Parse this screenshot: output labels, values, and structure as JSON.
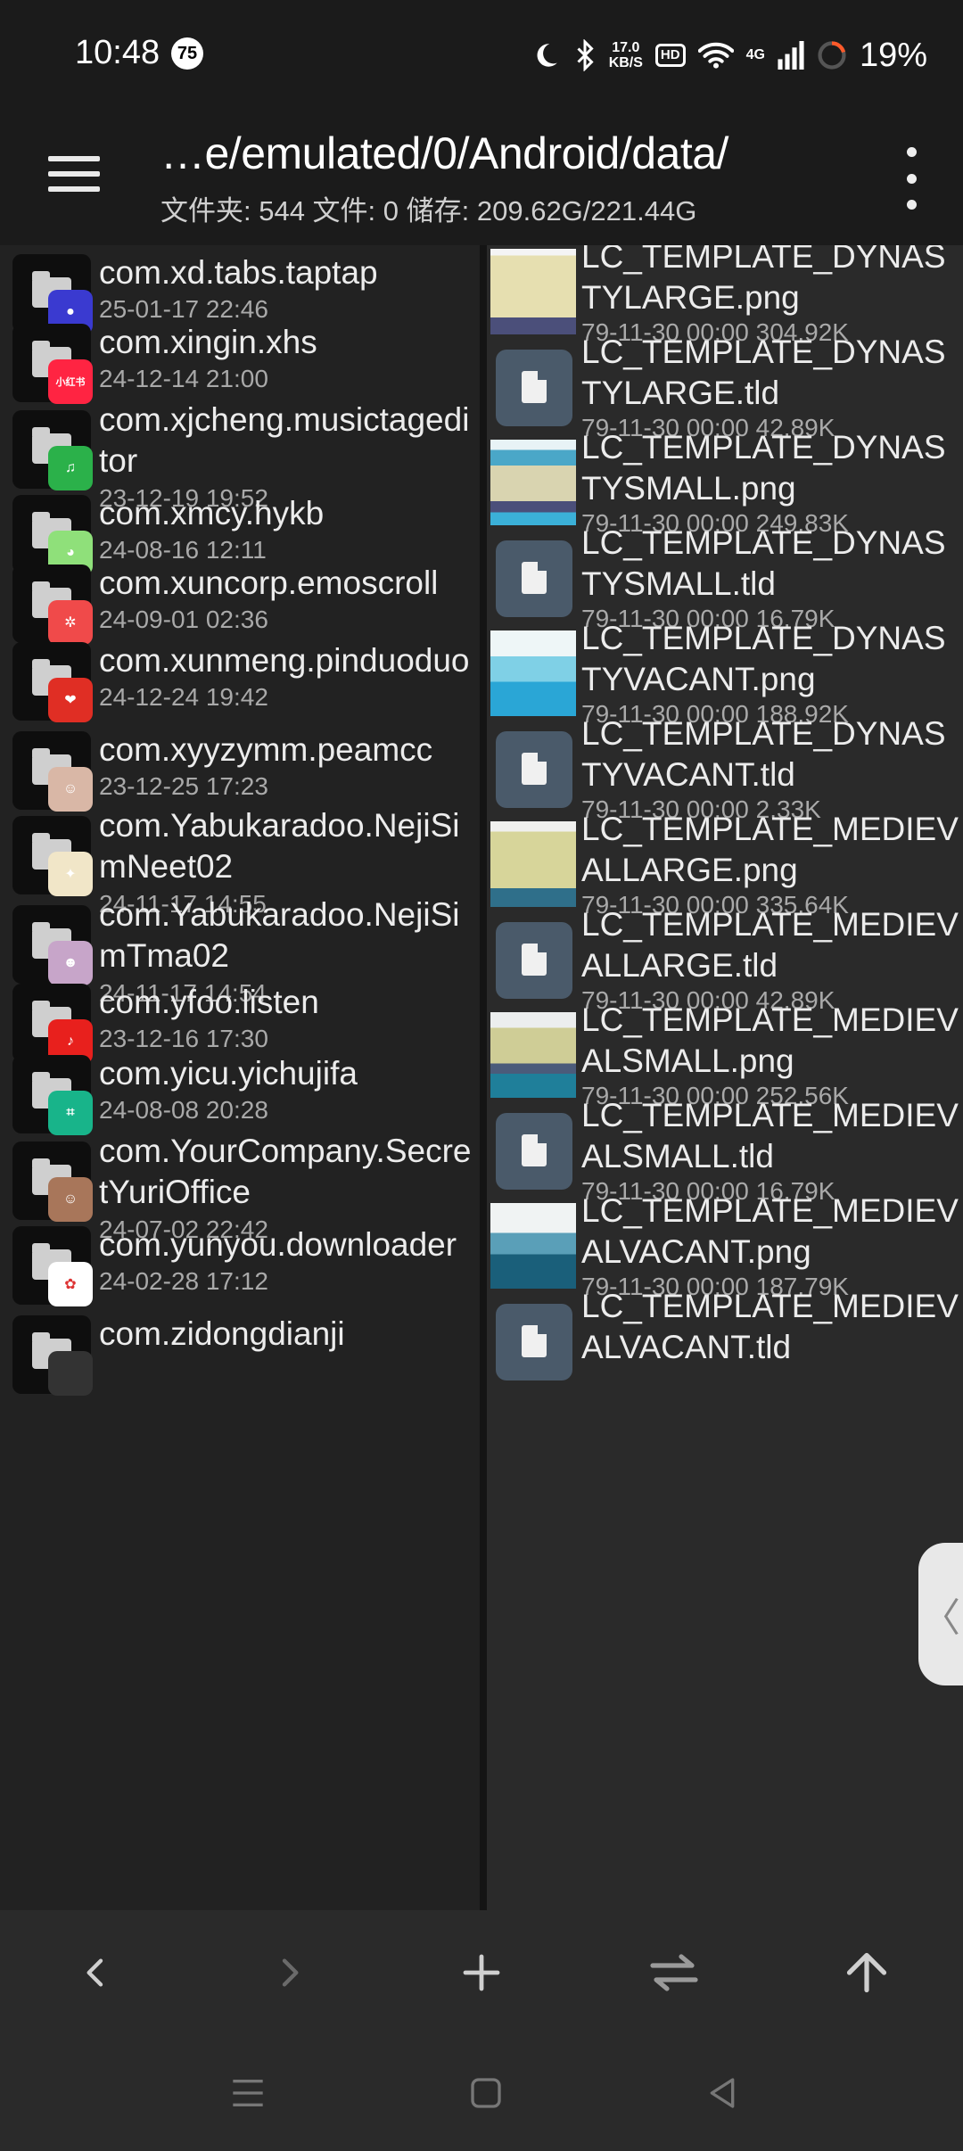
{
  "status": {
    "time": "10:48",
    "notification_count": "75",
    "speed_top": "17.0",
    "speed_unit": "KB/S",
    "hd": "HD",
    "network": "4G",
    "battery": "19%"
  },
  "appbar": {
    "path": "…e/emulated/0/Android/data/",
    "summary": "文件夹: 544  文件: 0  储存: 209.62G/221.44G"
  },
  "left_pane": {
    "items": [
      {
        "name": "com.xd.tabs.taptap",
        "date": "25-01-17 22:46",
        "icon": "taptap-icon",
        "color": "#3a3ad0",
        "glyph": "●"
      },
      {
        "name": "com.xingin.xhs",
        "date": "24-12-14 21:00",
        "icon": "xiaohongshu-icon",
        "color": "#ff2442",
        "glyph": "小红书"
      },
      {
        "name": "com.xjcheng.musictageditor",
        "date": "23-12-19 19:52",
        "icon": "music-note-icon",
        "color": "#2bb14a",
        "glyph": "♫"
      },
      {
        "name": "com.xmcy.hykb",
        "date": "24-08-16 12:11",
        "icon": "hykb-icon",
        "color": "#8fe07a",
        "glyph": "◕"
      },
      {
        "name": "com.xuncorp.emoscroll",
        "date": "24-09-01 02:36",
        "icon": "emoscroll-icon",
        "color": "#f04a4a",
        "glyph": "✲"
      },
      {
        "name": "com.xunmeng.pinduoduo",
        "date": "24-12-24 19:42",
        "icon": "pinduoduo-icon",
        "color": "#e02e24",
        "glyph": "❤"
      },
      {
        "name": "com.xyyzymm.peamcc",
        "date": "23-12-25 17:23",
        "icon": "anime-avatar-icon",
        "color": "#d9b7a6",
        "glyph": "☺"
      },
      {
        "name": "com.Yabukaradoo.NejiSimNeet02",
        "date": "24-11-17 14:55",
        "icon": "game-logo-icon",
        "color": "#f1e6c8",
        "glyph": "✦"
      },
      {
        "name": "com.Yabukaradoo.NejiSimTma02",
        "date": "24-11-17 14:54",
        "icon": "game-character-icon",
        "color": "#c7a5c9",
        "glyph": "☻"
      },
      {
        "name": "com.yfoo.listen",
        "date": "23-12-16 17:30",
        "icon": "music-listen-icon",
        "color": "#e8201d",
        "glyph": "♪"
      },
      {
        "name": "com.yicu.yichujifa",
        "date": "24-08-08 20:28",
        "icon": "scan-icon",
        "color": "#18b48a",
        "glyph": "⌗"
      },
      {
        "name": "com.YourCompany.SecretYuriOffice",
        "date": "24-07-02 22:42",
        "icon": "girl-avatar-icon",
        "color": "#a8765a",
        "glyph": "☺"
      },
      {
        "name": "com.yunyou.downloader",
        "date": "24-02-28 17:12",
        "icon": "downloader-icon",
        "color": "#ffffff",
        "glyph": "✿"
      },
      {
        "name": "com.zidongdianji",
        "date": "",
        "icon": "app-icon",
        "color": "#333333",
        "glyph": ""
      }
    ]
  },
  "right_pane": {
    "items": [
      {
        "name": "LC_TEMPLATE_DYNASTYLARGE.png",
        "date": "79-11-30 00:00",
        "size": "304.92K",
        "kind": "image",
        "thumb": "dynasty-large"
      },
      {
        "name": "LC_TEMPLATE_DYNASTYLARGE.tld",
        "date": "79-11-30 00:00",
        "size": "42.89K",
        "kind": "doc"
      },
      {
        "name": "LC_TEMPLATE_DYNASTYSMALL.png",
        "date": "79-11-30 00:00",
        "size": "249.83K",
        "kind": "image",
        "thumb": "dynasty-small"
      },
      {
        "name": "LC_TEMPLATE_DYNASTYSMALL.tld",
        "date": "79-11-30 00:00",
        "size": "16.79K",
        "kind": "doc"
      },
      {
        "name": "LC_TEMPLATE_DYNASTYVACANT.png",
        "date": "79-11-30 00:00",
        "size": "188.92K",
        "kind": "image",
        "thumb": "dynasty-vacant"
      },
      {
        "name": "LC_TEMPLATE_DYNASTYVACANT.tld",
        "date": "79-11-30 00:00",
        "size": "2.33K",
        "kind": "doc"
      },
      {
        "name": "LC_TEMPLATE_MEDIEVALLARGE.png",
        "date": "79-11-30 00:00",
        "size": "335.64K",
        "kind": "image",
        "thumb": "medieval-large"
      },
      {
        "name": "LC_TEMPLATE_MEDIEVALLARGE.tld",
        "date": "79-11-30 00:00",
        "size": "42.89K",
        "kind": "doc"
      },
      {
        "name": "LC_TEMPLATE_MEDIEVALSMALL.png",
        "date": "79-11-30 00:00",
        "size": "252.56K",
        "kind": "image",
        "thumb": "medieval-small"
      },
      {
        "name": "LC_TEMPLATE_MEDIEVALSMALL.tld",
        "date": "79-11-30 00:00",
        "size": "16.79K",
        "kind": "doc"
      },
      {
        "name": "LC_TEMPLATE_MEDIEVALVACANT.png",
        "date": "79-11-30 00:00",
        "size": "187.79K",
        "kind": "image",
        "thumb": "medieval-vacant"
      },
      {
        "name": "LC_TEMPLATE_MEDIEVALVACANT.tld",
        "date": "",
        "size": "",
        "kind": "doc"
      }
    ]
  },
  "toolbar": {
    "back": "back-icon",
    "forward": "forward-icon",
    "add": "add-icon",
    "swap": "swap-icon",
    "up": "up-icon"
  },
  "side_handle": "〈"
}
